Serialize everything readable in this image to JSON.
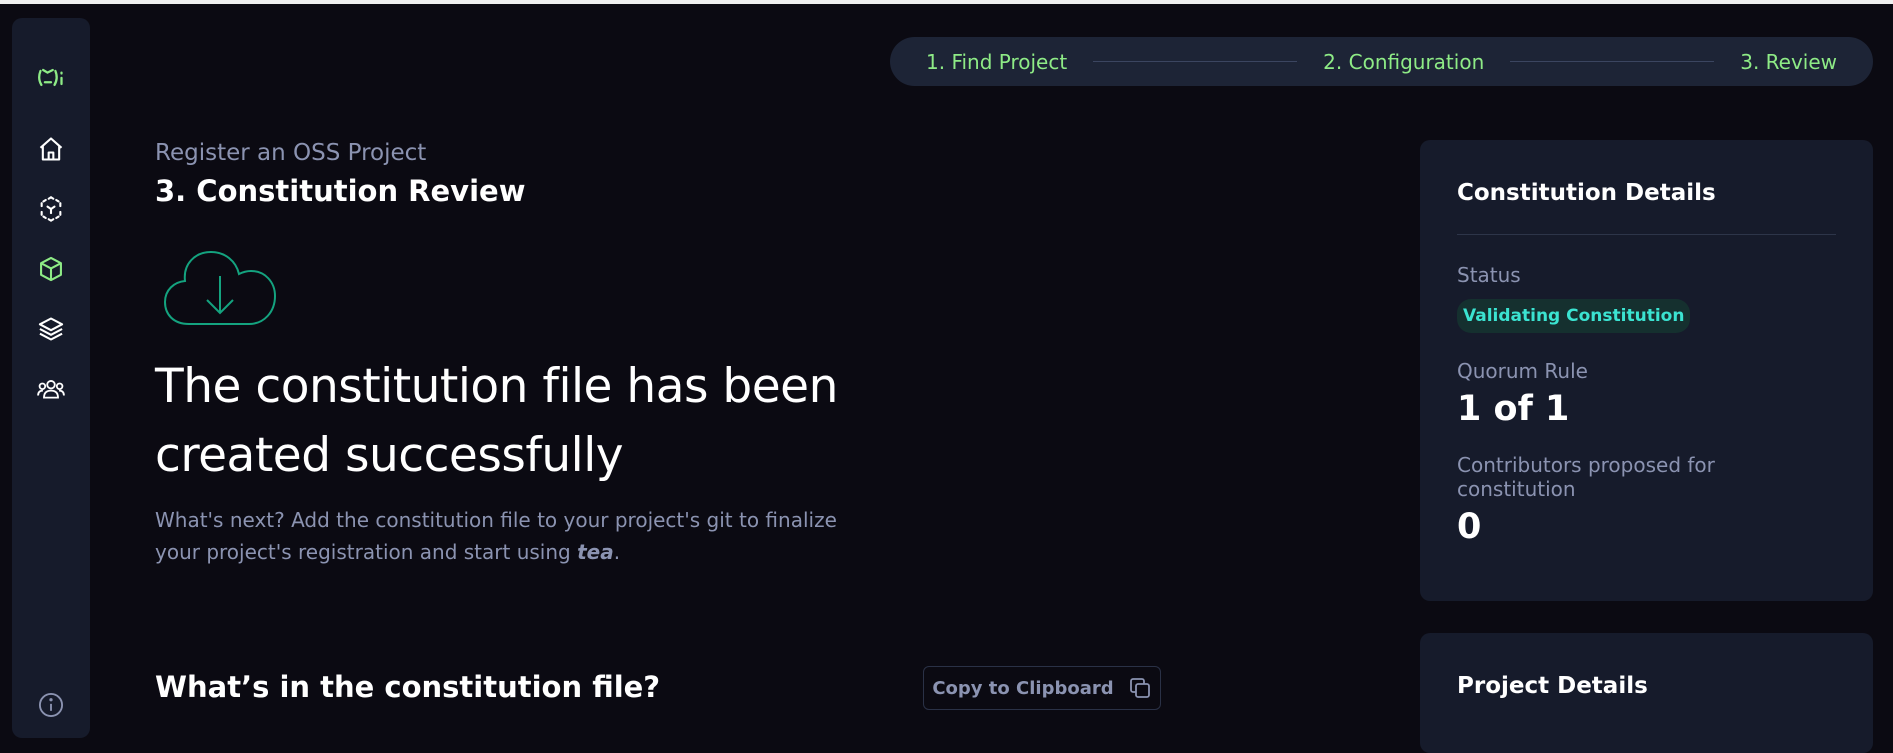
{
  "stepper": {
    "steps": [
      "1. Find Project",
      "2. Configuration",
      "3. Review"
    ]
  },
  "sidebar": {
    "items": [
      "logo-icon",
      "home-icon",
      "cube-network-icon",
      "package-icon",
      "layers-icon",
      "users-icon",
      "info-icon"
    ]
  },
  "main": {
    "breadcrumb": "Register an OSS Project",
    "title": "3. Constitution Review",
    "hero": "The constitution file has been created successfully",
    "description_pre": "What's next? Add the constitution file to your project's git to finalize your project's registration and start using ",
    "description_tea": "tea",
    "description_post": ".",
    "section_title": "What’s in the constitution file?",
    "copy_label": "Copy to Clipboard"
  },
  "constitution_details": {
    "title": "Constitution Details",
    "status_label": "Status",
    "status_value": "Validating Constitution",
    "quorum_label": "Quorum Rule",
    "quorum_value": "1 of 1",
    "contributors_label": "Contributors proposed for constitution",
    "contributors_value": "0"
  },
  "project_details": {
    "title": "Project Details"
  },
  "colors": {
    "background": "#0b0a12",
    "panel": "#161b2b",
    "accent_green": "#8eeb86",
    "badge_text": "#3be3d1",
    "muted_text": "#8b93b1"
  }
}
